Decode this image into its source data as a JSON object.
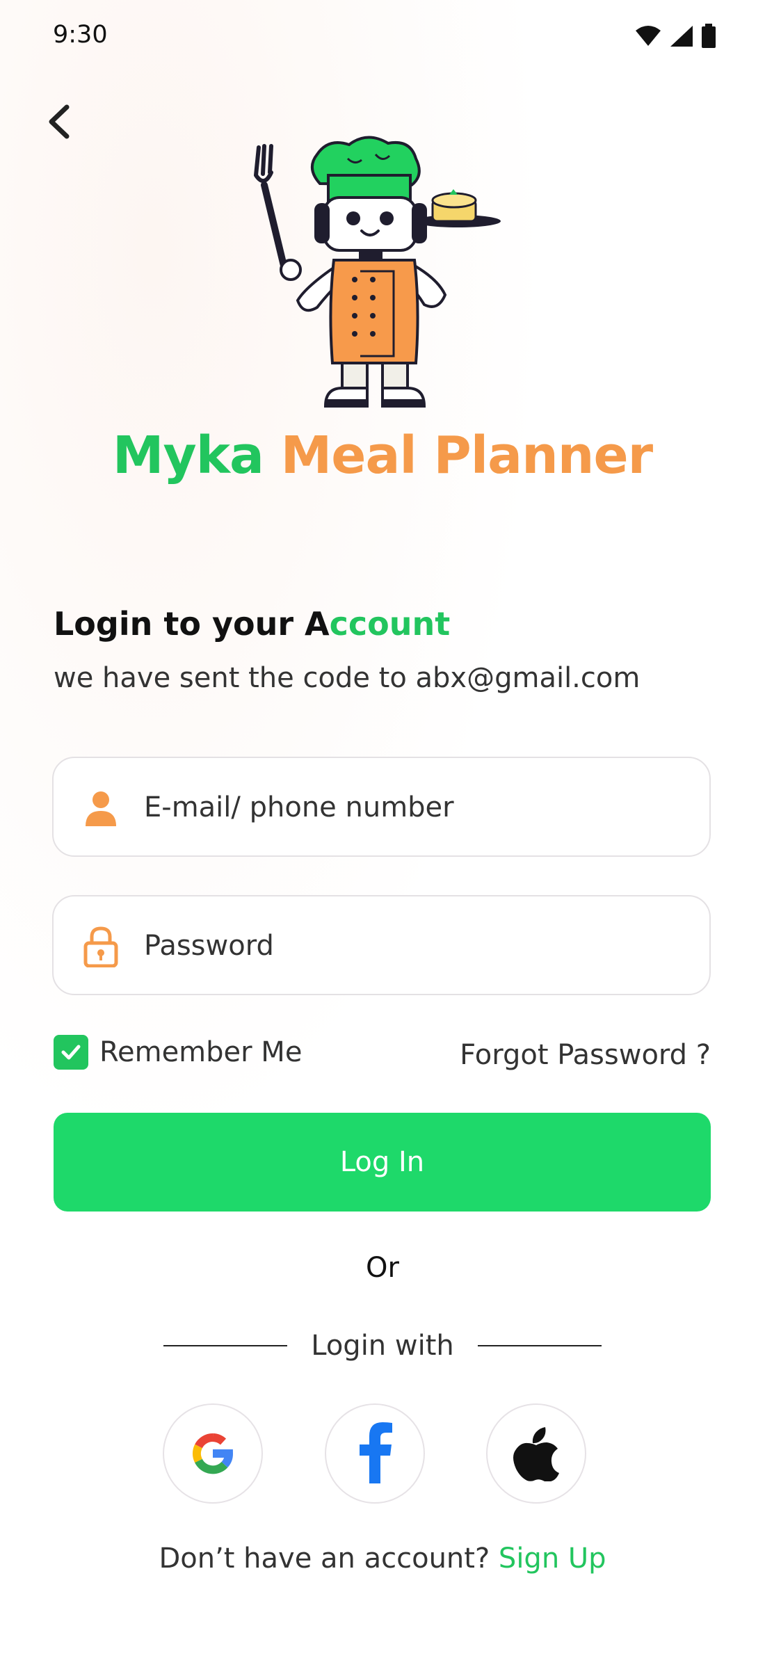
{
  "status_bar": {
    "time": "9:30",
    "icons": [
      "wifi-icon",
      "signal-icon",
      "battery-icon"
    ]
  },
  "app": {
    "title_part1": "Myka",
    "title_part2": "Meal Planner",
    "brand_green": "#22c55e",
    "brand_orange": "#f59a4a"
  },
  "login": {
    "heading_prefix": "Login to your A",
    "heading_accent": "ccount",
    "subtext": "we have sent the code to abx@gmail.com",
    "email_placeholder": "E-mail/ phone number",
    "password_placeholder": "Password",
    "remember_label": "Remember Me",
    "remember_checked": true,
    "forgot_label": "Forgot Password ?",
    "login_button": "Log In",
    "or_label": "Or",
    "login_with_label": "Login with",
    "social": [
      "google-icon",
      "facebook-icon",
      "apple-icon"
    ],
    "signup_prompt": "Don’t have an account?",
    "signup_link": "Sign Up"
  }
}
